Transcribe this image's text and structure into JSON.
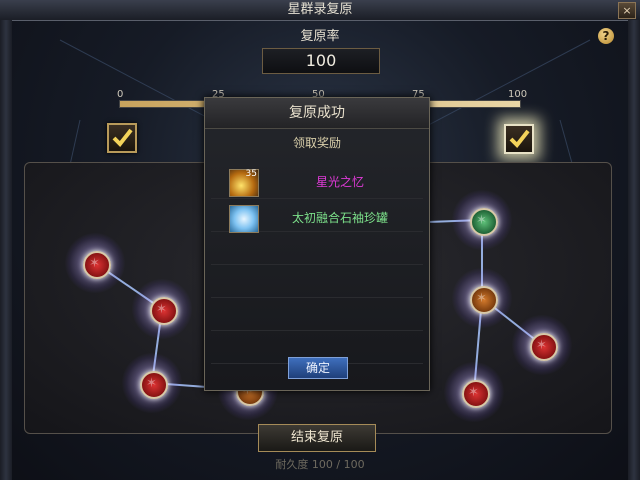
{
  "window": {
    "title": "星群录复原",
    "close_label": "×"
  },
  "help": {
    "label": "?"
  },
  "restore_rate": {
    "label": "复原率",
    "value": "100"
  },
  "progress": {
    "ticks": [
      "0",
      "25",
      "50",
      "75",
      "100"
    ],
    "fill_percent": 100
  },
  "milestones": [
    {
      "icon": "check-box-icon",
      "state": "claimed"
    },
    {
      "icon": "check-box-icon",
      "state": "claimed-glow"
    }
  ],
  "constellation": {
    "nodes": [
      {
        "color": "red"
      },
      {
        "color": "red"
      },
      {
        "color": "red"
      },
      {
        "color": "orange"
      },
      {
        "color": "green"
      },
      {
        "color": "orange"
      },
      {
        "color": "red"
      },
      {
        "color": "red"
      }
    ]
  },
  "modal": {
    "title": "复原成功",
    "subtitle": "领取奖励",
    "rewards": [
      {
        "name": "星光之忆",
        "count": "35",
        "color": "#e03ad8",
        "icon": "starlight-icon"
      },
      {
        "name": "太初融合石袖珍罐",
        "count": "",
        "color": "#7ce08a",
        "icon": "crystal-jar-icon"
      }
    ],
    "confirm_label": "确定"
  },
  "end_button": {
    "label": "结束复原"
  },
  "durability": {
    "label": "耐久度",
    "current": "100",
    "max": "100",
    "text": "耐久度  100  /  100"
  },
  "colors": {
    "accent_gold": "#b89a5a",
    "confirm_blue": "#2f5aa3",
    "frame_dark": "#161b26"
  }
}
